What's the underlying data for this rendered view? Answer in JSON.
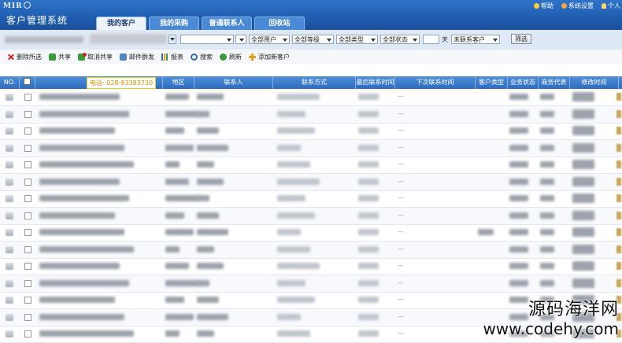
{
  "header": {
    "logo": "MIR",
    "title": "客户管理系统",
    "tabs": [
      {
        "label": "我的客户",
        "active": true
      },
      {
        "label": "我的采购",
        "active": false
      },
      {
        "label": "普通联系人",
        "active": false
      },
      {
        "label": "回收站",
        "active": false
      }
    ],
    "links": {
      "help": "帮助",
      "settings": "系统设置",
      "personal": "个人"
    }
  },
  "filters": {
    "select1": "",
    "user": "全部用户",
    "level": "全部等级",
    "type": "全部类型",
    "status": "全部状态",
    "days_value": "",
    "days_label": "天",
    "uncontacted": "未联系客户",
    "filter_button": "筛选"
  },
  "toolbar": {
    "delete": "删除所选",
    "share": "共享",
    "unshare": "取消共享",
    "mail": "邮件群发",
    "report": "报表",
    "search": "搜索",
    "refresh": "刷新",
    "add": "添加新客户"
  },
  "grid": {
    "columns": {
      "no": "NO.",
      "region": "地区",
      "contact": "联系人",
      "method": "联系方式",
      "last_contact": "最后联系时间",
      "next_contact": "下次联系时间",
      "customer_type": "客户类型",
      "business_status": "业务状态",
      "sales_rep": "商务代表",
      "modified": "修改时间"
    },
    "tooltip": "电话: 028-83383730",
    "row_dash": "—",
    "row_count": 15
  },
  "watermark": {
    "line1": "源码海洋网",
    "line2": "www.codehy.com"
  },
  "colors": {
    "header_blue": "#1f5db0",
    "grid_header": "#2d6bbd",
    "tooltip_text": "#d98f00"
  }
}
